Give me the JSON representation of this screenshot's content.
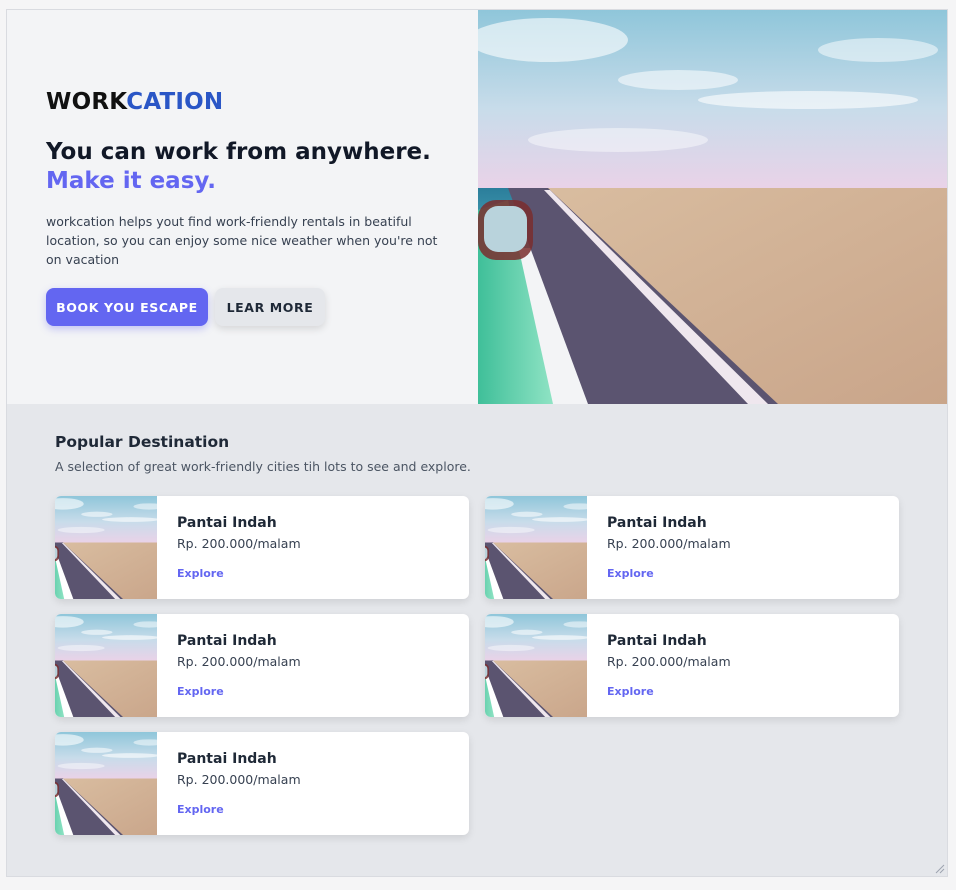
{
  "brand": {
    "part1": "WORK",
    "part2": "CATION"
  },
  "hero": {
    "headline": "You can work from anywhere.",
    "headline_accent": "Make it easy.",
    "description": "workcation helps yout find work-friendly rentals in beatiful location, so you can enjoy some nice weather when you're not on vacation",
    "primary_button": "BOOK YOU ESCAPE",
    "secondary_button": "LEAR MORE"
  },
  "popular": {
    "title": "Popular Destination",
    "subtitle": "A selection of great work-friendly cities tih lots to see and explore.",
    "cards": [
      {
        "title": "Pantai Indah",
        "price": "Rp. 200.000/malam",
        "link": "Explore"
      },
      {
        "title": "Pantai Indah",
        "price": "Rp. 200.000/malam",
        "link": "Explore"
      },
      {
        "title": "Pantai Indah",
        "price": "Rp. 200.000/malam",
        "link": "Explore"
      },
      {
        "title": "Pantai Indah",
        "price": "Rp. 200.000/malam",
        "link": "Explore"
      },
      {
        "title": "Pantai Indah",
        "price": "Rp. 200.000/malam",
        "link": "Explore"
      }
    ]
  },
  "colors": {
    "accent": "#6366f1",
    "brand_blue": "#2a56c6",
    "hero_bg": "#f3f4f6",
    "section_bg": "#e5e7eb"
  },
  "icons": {
    "resize": "resize-handle-icon"
  }
}
